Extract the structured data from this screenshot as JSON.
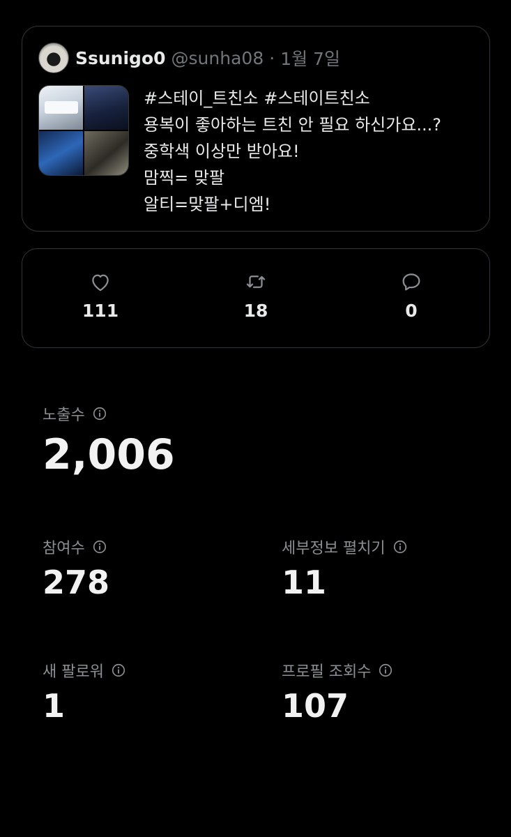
{
  "tweet": {
    "author_name": "Ssunigo0",
    "handle": "@sunha08",
    "separator": "·",
    "date": "1월 7일",
    "lines": [
      "#스테이_트친소 #스테이트친소",
      "용복이 좋아하는 트친 안 필요 하신가요...?",
      "중학색 이상만 받아요!",
      "맘찍= 맞팔",
      "알티=맞팔+디엠!"
    ]
  },
  "actions": {
    "likes": "111",
    "retweets": "18",
    "replies": "0"
  },
  "metrics": {
    "impressions": {
      "label": "노출수",
      "value": "2,006"
    },
    "engagements": {
      "label": "참여수",
      "value": "278"
    },
    "detail_expands": {
      "label": "세부정보 펼치기",
      "value": "11"
    },
    "new_followers": {
      "label": "새 팔로워",
      "value": "1"
    },
    "profile_visits": {
      "label": "프로필 조회수",
      "value": "107"
    }
  },
  "icons": {
    "like": "heart-icon",
    "retweet": "retweet-icon",
    "reply": "reply-icon",
    "info": "info-icon"
  },
  "colors": {
    "background": "#000000",
    "border": "#333639",
    "text": "#e7e9ea",
    "muted": "#71767b"
  }
}
